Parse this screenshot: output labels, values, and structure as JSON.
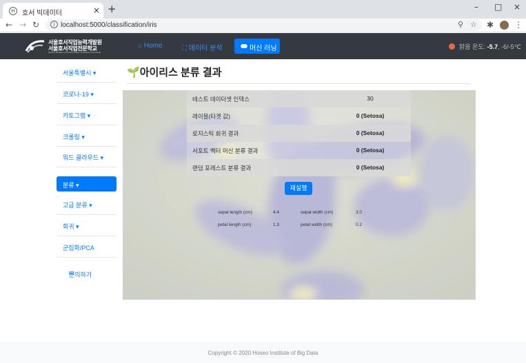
{
  "browser": {
    "tab_title": "호서 빅데이터",
    "url": "localhost:5000/classification/iris"
  },
  "navbar": {
    "logo_line1": "서울호서직업능력개발원",
    "logo_line2": "서울호서직업전문학교",
    "logo_line3": "SEOUL HOSEO OCCUPATIONAL TRAINING COLLEGE",
    "links": [
      {
        "label": "Home"
      },
      {
        "label": "데이터 분석"
      },
      {
        "label": "머신 러닝"
      }
    ],
    "weather_label": "맑음 온도:",
    "weather_temp": "-5.7",
    "weather_range": ", -6/-5℃"
  },
  "sidebar": {
    "items": [
      {
        "label": "서울특별시 ▾"
      },
      {
        "label": "코로나-19 ▾"
      },
      {
        "label": "카토그램 ▾"
      },
      {
        "label": "크롤링 ▾"
      },
      {
        "label": "워드 클라우드 ▾"
      },
      {
        "label": "분류 ▾"
      },
      {
        "label": "고급 분류 ▾"
      },
      {
        "label": "회귀 ▾"
      },
      {
        "label": "군집화/PCA"
      },
      {
        "label": "문의하기"
      }
    ]
  },
  "main": {
    "title": "아이리스 분류 결과",
    "results": [
      {
        "key": "테스트 데이터셋 인덱스",
        "value": "30"
      },
      {
        "key": "레이블(타겟 값)",
        "value": "0 (Setosa)"
      },
      {
        "key": "로지스틱 회귀 결과",
        "value": "0 (Setosa)"
      },
      {
        "key": "서포트 벡터 머신 분류 결과",
        "value": "0 (Setosa)"
      },
      {
        "key": "랜덤 포레스트 분류 결과",
        "value": "0 (Setosa)"
      }
    ],
    "rerun_label": "재실행",
    "features": {
      "sepal_length_label": "sepal length (cm)",
      "sepal_length": "4.4",
      "sepal_width_label": "sepal width (cm)",
      "sepal_width": "3.0",
      "petal_length_label": "petal length (cm)",
      "petal_length": "1.3",
      "petal_width_label": "petal width (cm)",
      "petal_width": "0.2"
    }
  },
  "footer": {
    "copyright": "Copyright © 2020 Hoseo Institute of Big Data"
  },
  "colors": {
    "primary": "#007bff",
    "navbar_bg": "#343a40",
    "weather_dot": "#e8684a"
  }
}
